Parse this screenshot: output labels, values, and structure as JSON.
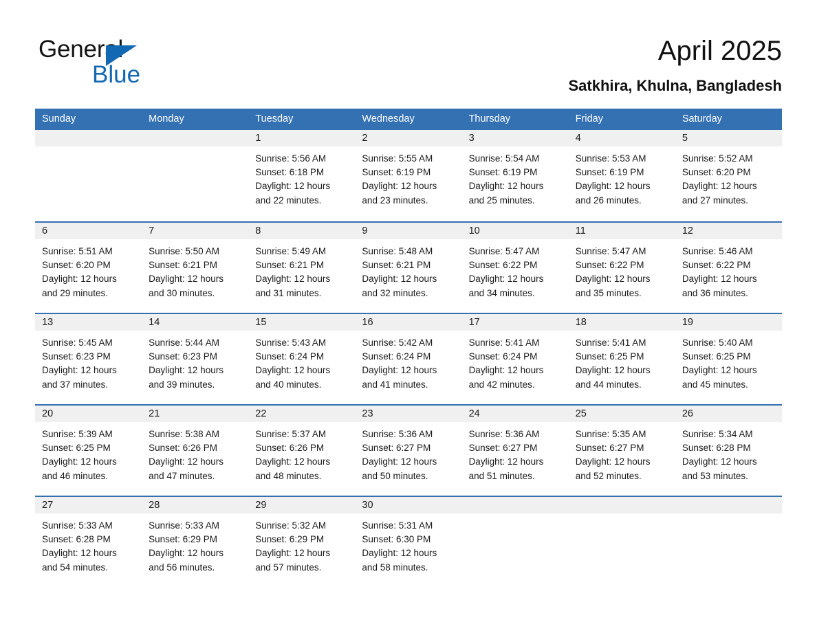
{
  "brand": {
    "name_part1": "General",
    "name_part2": "Blue",
    "accent_color": "#1268b3",
    "triangle_icon": "triangle-icon"
  },
  "header": {
    "title": "April 2025",
    "location": "Satkhira, Khulna, Bangladesh"
  },
  "calendar": {
    "header_color": "#3471b3",
    "weekday_headers": [
      "Sunday",
      "Monday",
      "Tuesday",
      "Wednesday",
      "Thursday",
      "Friday",
      "Saturday"
    ],
    "weeks": [
      [
        {
          "day": "",
          "sunrise": "",
          "sunset": "",
          "daylight_line1": "",
          "daylight_line2": "",
          "empty": true
        },
        {
          "day": "",
          "sunrise": "",
          "sunset": "",
          "daylight_line1": "",
          "daylight_line2": "",
          "empty": true
        },
        {
          "day": "1",
          "sunrise": "Sunrise: 5:56 AM",
          "sunset": "Sunset: 6:18 PM",
          "daylight_line1": "Daylight: 12 hours",
          "daylight_line2": "and 22 minutes.",
          "empty": false
        },
        {
          "day": "2",
          "sunrise": "Sunrise: 5:55 AM",
          "sunset": "Sunset: 6:19 PM",
          "daylight_line1": "Daylight: 12 hours",
          "daylight_line2": "and 23 minutes.",
          "empty": false
        },
        {
          "day": "3",
          "sunrise": "Sunrise: 5:54 AM",
          "sunset": "Sunset: 6:19 PM",
          "daylight_line1": "Daylight: 12 hours",
          "daylight_line2": "and 25 minutes.",
          "empty": false
        },
        {
          "day": "4",
          "sunrise": "Sunrise: 5:53 AM",
          "sunset": "Sunset: 6:19 PM",
          "daylight_line1": "Daylight: 12 hours",
          "daylight_line2": "and 26 minutes.",
          "empty": false
        },
        {
          "day": "5",
          "sunrise": "Sunrise: 5:52 AM",
          "sunset": "Sunset: 6:20 PM",
          "daylight_line1": "Daylight: 12 hours",
          "daylight_line2": "and 27 minutes.",
          "empty": false
        }
      ],
      [
        {
          "day": "6",
          "sunrise": "Sunrise: 5:51 AM",
          "sunset": "Sunset: 6:20 PM",
          "daylight_line1": "Daylight: 12 hours",
          "daylight_line2": "and 29 minutes.",
          "empty": false
        },
        {
          "day": "7",
          "sunrise": "Sunrise: 5:50 AM",
          "sunset": "Sunset: 6:21 PM",
          "daylight_line1": "Daylight: 12 hours",
          "daylight_line2": "and 30 minutes.",
          "empty": false
        },
        {
          "day": "8",
          "sunrise": "Sunrise: 5:49 AM",
          "sunset": "Sunset: 6:21 PM",
          "daylight_line1": "Daylight: 12 hours",
          "daylight_line2": "and 31 minutes.",
          "empty": false
        },
        {
          "day": "9",
          "sunrise": "Sunrise: 5:48 AM",
          "sunset": "Sunset: 6:21 PM",
          "daylight_line1": "Daylight: 12 hours",
          "daylight_line2": "and 32 minutes.",
          "empty": false
        },
        {
          "day": "10",
          "sunrise": "Sunrise: 5:47 AM",
          "sunset": "Sunset: 6:22 PM",
          "daylight_line1": "Daylight: 12 hours",
          "daylight_line2": "and 34 minutes.",
          "empty": false
        },
        {
          "day": "11",
          "sunrise": "Sunrise: 5:47 AM",
          "sunset": "Sunset: 6:22 PM",
          "daylight_line1": "Daylight: 12 hours",
          "daylight_line2": "and 35 minutes.",
          "empty": false
        },
        {
          "day": "12",
          "sunrise": "Sunrise: 5:46 AM",
          "sunset": "Sunset: 6:22 PM",
          "daylight_line1": "Daylight: 12 hours",
          "daylight_line2": "and 36 minutes.",
          "empty": false
        }
      ],
      [
        {
          "day": "13",
          "sunrise": "Sunrise: 5:45 AM",
          "sunset": "Sunset: 6:23 PM",
          "daylight_line1": "Daylight: 12 hours",
          "daylight_line2": "and 37 minutes.",
          "empty": false
        },
        {
          "day": "14",
          "sunrise": "Sunrise: 5:44 AM",
          "sunset": "Sunset: 6:23 PM",
          "daylight_line1": "Daylight: 12 hours",
          "daylight_line2": "and 39 minutes.",
          "empty": false
        },
        {
          "day": "15",
          "sunrise": "Sunrise: 5:43 AM",
          "sunset": "Sunset: 6:24 PM",
          "daylight_line1": "Daylight: 12 hours",
          "daylight_line2": "and 40 minutes.",
          "empty": false
        },
        {
          "day": "16",
          "sunrise": "Sunrise: 5:42 AM",
          "sunset": "Sunset: 6:24 PM",
          "daylight_line1": "Daylight: 12 hours",
          "daylight_line2": "and 41 minutes.",
          "empty": false
        },
        {
          "day": "17",
          "sunrise": "Sunrise: 5:41 AM",
          "sunset": "Sunset: 6:24 PM",
          "daylight_line1": "Daylight: 12 hours",
          "daylight_line2": "and 42 minutes.",
          "empty": false
        },
        {
          "day": "18",
          "sunrise": "Sunrise: 5:41 AM",
          "sunset": "Sunset: 6:25 PM",
          "daylight_line1": "Daylight: 12 hours",
          "daylight_line2": "and 44 minutes.",
          "empty": false
        },
        {
          "day": "19",
          "sunrise": "Sunrise: 5:40 AM",
          "sunset": "Sunset: 6:25 PM",
          "daylight_line1": "Daylight: 12 hours",
          "daylight_line2": "and 45 minutes.",
          "empty": false
        }
      ],
      [
        {
          "day": "20",
          "sunrise": "Sunrise: 5:39 AM",
          "sunset": "Sunset: 6:25 PM",
          "daylight_line1": "Daylight: 12 hours",
          "daylight_line2": "and 46 minutes.",
          "empty": false
        },
        {
          "day": "21",
          "sunrise": "Sunrise: 5:38 AM",
          "sunset": "Sunset: 6:26 PM",
          "daylight_line1": "Daylight: 12 hours",
          "daylight_line2": "and 47 minutes.",
          "empty": false
        },
        {
          "day": "22",
          "sunrise": "Sunrise: 5:37 AM",
          "sunset": "Sunset: 6:26 PM",
          "daylight_line1": "Daylight: 12 hours",
          "daylight_line2": "and 48 minutes.",
          "empty": false
        },
        {
          "day": "23",
          "sunrise": "Sunrise: 5:36 AM",
          "sunset": "Sunset: 6:27 PM",
          "daylight_line1": "Daylight: 12 hours",
          "daylight_line2": "and 50 minutes.",
          "empty": false
        },
        {
          "day": "24",
          "sunrise": "Sunrise: 5:36 AM",
          "sunset": "Sunset: 6:27 PM",
          "daylight_line1": "Daylight: 12 hours",
          "daylight_line2": "and 51 minutes.",
          "empty": false
        },
        {
          "day": "25",
          "sunrise": "Sunrise: 5:35 AM",
          "sunset": "Sunset: 6:27 PM",
          "daylight_line1": "Daylight: 12 hours",
          "daylight_line2": "and 52 minutes.",
          "empty": false
        },
        {
          "day": "26",
          "sunrise": "Sunrise: 5:34 AM",
          "sunset": "Sunset: 6:28 PM",
          "daylight_line1": "Daylight: 12 hours",
          "daylight_line2": "and 53 minutes.",
          "empty": false
        }
      ],
      [
        {
          "day": "27",
          "sunrise": "Sunrise: 5:33 AM",
          "sunset": "Sunset: 6:28 PM",
          "daylight_line1": "Daylight: 12 hours",
          "daylight_line2": "and 54 minutes.",
          "empty": false
        },
        {
          "day": "28",
          "sunrise": "Sunrise: 5:33 AM",
          "sunset": "Sunset: 6:29 PM",
          "daylight_line1": "Daylight: 12 hours",
          "daylight_line2": "and 56 minutes.",
          "empty": false
        },
        {
          "day": "29",
          "sunrise": "Sunrise: 5:32 AM",
          "sunset": "Sunset: 6:29 PM",
          "daylight_line1": "Daylight: 12 hours",
          "daylight_line2": "and 57 minutes.",
          "empty": false
        },
        {
          "day": "30",
          "sunrise": "Sunrise: 5:31 AM",
          "sunset": "Sunset: 6:30 PM",
          "daylight_line1": "Daylight: 12 hours",
          "daylight_line2": "and 58 minutes.",
          "empty": false
        },
        {
          "day": "",
          "sunrise": "",
          "sunset": "",
          "daylight_line1": "",
          "daylight_line2": "",
          "empty": true
        },
        {
          "day": "",
          "sunrise": "",
          "sunset": "",
          "daylight_line1": "",
          "daylight_line2": "",
          "empty": true
        },
        {
          "day": "",
          "sunrise": "",
          "sunset": "",
          "daylight_line1": "",
          "daylight_line2": "",
          "empty": true
        }
      ]
    ]
  }
}
